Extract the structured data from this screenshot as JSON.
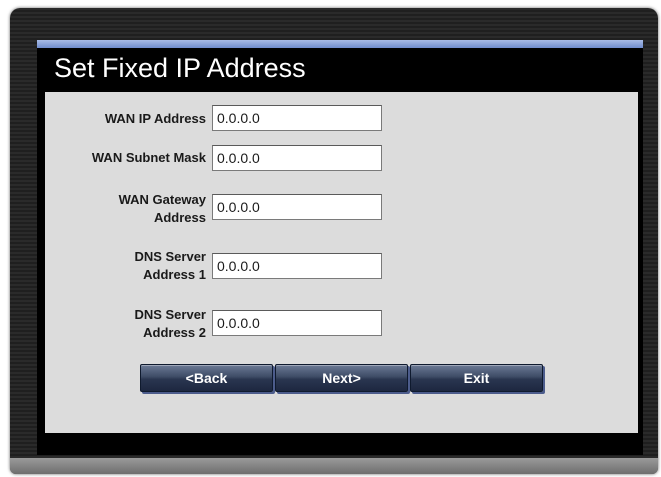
{
  "window": {
    "title": "Set Fixed IP Address"
  },
  "form": {
    "fields": [
      {
        "label_lines": [
          "WAN IP Address"
        ],
        "value": "0.0.0.0"
      },
      {
        "label_lines": [
          "WAN Subnet Mask"
        ],
        "value": "0.0.0.0"
      },
      {
        "label_lines": [
          "WAN Gateway",
          "Address"
        ],
        "value": "0.0.0.0"
      },
      {
        "label_lines": [
          "DNS Server",
          "Address 1"
        ],
        "value": "0.0.0.0"
      },
      {
        "label_lines": [
          "DNS Server",
          "Address 2"
        ],
        "value": "0.0.0.0"
      }
    ]
  },
  "buttons": {
    "back_label": "<Back",
    "next_label": "Next>",
    "exit_label": "Exit"
  },
  "colors": {
    "accent_bar": "#8fa6d9",
    "panel": "#000000",
    "form_background": "#dcdcdc",
    "button_background": "#2f3b55"
  }
}
